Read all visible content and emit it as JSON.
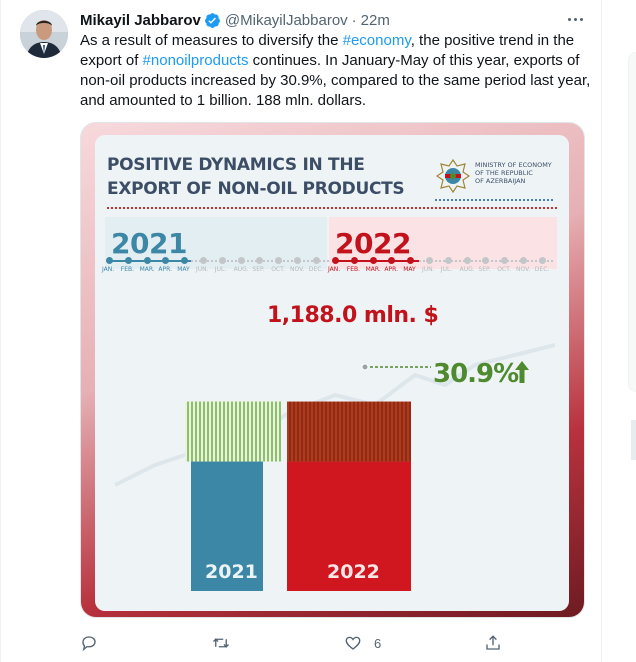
{
  "tweet": {
    "author_name": "Mikayil Jabbarov",
    "handle": "@MikayilJabbarov",
    "separator": "·",
    "time": "22m",
    "text_parts": {
      "p1": "As a result of measures to diversify the ",
      "tag1": "#economy",
      "p2": ", the positive trend in the export of ",
      "tag2": "#nonoilproducts",
      "p3": " continues. In January-May of this year, exports of non-oil products increased by 30.9%, compared to the same period last year, and amounted to 1 billion. 188 mln. dollars."
    },
    "icons": {
      "verified": "verified-badge-icon",
      "more": "more-options-icon",
      "reply": "reply-icon",
      "retweet": "retweet-icon",
      "like": "like-icon",
      "share": "share-icon"
    },
    "like_count": "6",
    "accent_color": "#1d9bf0"
  },
  "infographic": {
    "title_line1": "POSITIVE DYNAMICS IN THE",
    "title_line2": "EXPORT OF NON-OIL PRODUCTS",
    "ministry_line1": "MINISTRY OF ECONOMY",
    "ministry_line2": "OF THE REPUBLIC",
    "ministry_line3": "OF AZERBAIJAN",
    "year_2021": "2021",
    "year_2022": "2022",
    "months": [
      "JAN.",
      "FEB.",
      "MAR.",
      "APR.",
      "MAY",
      "JUN.",
      "JUL.",
      "AUG.",
      "SEP.",
      "OCT.",
      "NOV.",
      "DEC."
    ],
    "active_months": 5,
    "value_2022": "1,188.0 mln. $",
    "growth": "30.9%",
    "colors": {
      "blue": "#3d87a6",
      "red": "#c2131d",
      "green": "#4f8a2f",
      "title": "#3c4e66"
    }
  },
  "chart_data": {
    "type": "bar",
    "categories": [
      "2021",
      "2022"
    ],
    "values": [
      907.6,
      1188.0
    ],
    "unit": "mln. $",
    "growth_percent": 30.9,
    "growth_label": "30.9%",
    "value_label_2022": "1,188.0 mln. $"
  }
}
